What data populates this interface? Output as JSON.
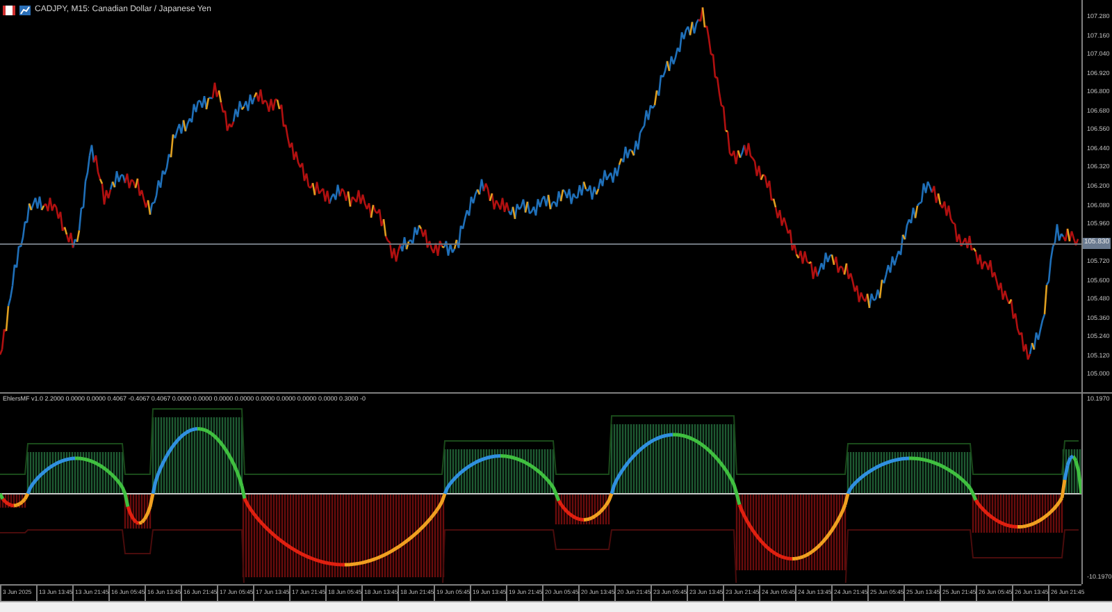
{
  "chart": {
    "symbol_title": "CADJPY, M15:  Canadian Dollar / Japanese Yen",
    "price_labels": [
      "107.280",
      "107.160",
      "107.040",
      "106.920",
      "106.800",
      "106.680",
      "106.560",
      "106.440",
      "106.320",
      "106.200",
      "106.080",
      "105.960",
      "105.720",
      "105.600",
      "105.480",
      "105.360",
      "105.240",
      "105.120",
      "105.000"
    ],
    "current_price": "105.830"
  },
  "indicator": {
    "title": "EhlersMF v1.0 2.2000 0.0000 0.0000 0.4067 -0.4067 0.4067 0.0000 0.0000 0.0000 0.0000 0.0000 0.0000 0.0000 0.0000 0.3000 -0",
    "top_label": "10.1970",
    "bottom_label": "-10.1970"
  },
  "time_labels": [
    "3 Jun 2025",
    "13 Jun 13:45",
    "13 Jun 21:45",
    "16 Jun 05:45",
    "16 Jun 13:45",
    "16 Jun 21:45",
    "17 Jun 05:45",
    "17 Jun 13:45",
    "17 Jun 21:45",
    "18 Jun 05:45",
    "18 Jun 13:45",
    "18 Jun 21:45",
    "19 Jun 05:45",
    "19 Jun 13:45",
    "19 Jun 21:45",
    "20 Jun 05:45",
    "20 Jun 13:45",
    "20 Jun 21:45",
    "23 Jun 05:45",
    "23 Jun 13:45",
    "23 Jun 21:45",
    "24 Jun 05:45",
    "24 Jun 13:45",
    "24 Jun 21:45",
    "25 Jun 05:45",
    "25 Jun 13:45",
    "25 Jun 21:45",
    "26 Jun 05:45",
    "26 Jun 13:45",
    "26 Jun 21:45"
  ]
}
